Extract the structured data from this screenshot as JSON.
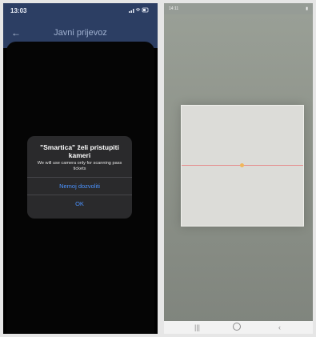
{
  "left_phone": {
    "status_time": "13:03",
    "status_icons": "signal-wifi-battery",
    "nav": {
      "back_icon": "arrow-left-icon",
      "title": "Javni prijevoz"
    },
    "alert": {
      "title": "\"Smartica\" želi pristupiti kameri",
      "message": "We will use camera only for scanning pass tickets",
      "deny_label": "Nemoj dozvoliti",
      "ok_label": "OK"
    },
    "colors": {
      "nav_bar": "#2c3e63",
      "alert_bg": "#2a2a2c",
      "accent": "#4b93ff"
    }
  },
  "right_phone": {
    "status_time": "14:11",
    "status_right": "battery 89%",
    "navigation_icons": [
      "recent-apps-icon",
      "home-icon",
      "back-icon"
    ]
  }
}
